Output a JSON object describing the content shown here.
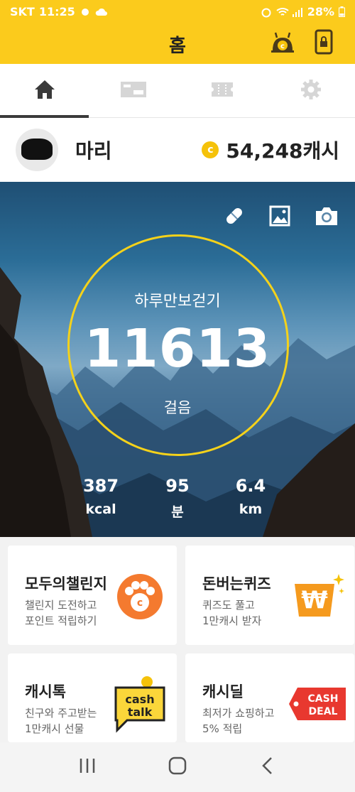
{
  "status_bar": {
    "carrier": "SKT",
    "time": "11:25",
    "battery": "28%"
  },
  "header": {
    "title": "홈"
  },
  "tabs": [
    {
      "name": "home-icon",
      "active": true
    },
    {
      "name": "ticket-icon",
      "active": false
    },
    {
      "name": "coupon-icon",
      "active": false
    },
    {
      "name": "gear-icon",
      "active": false
    }
  ],
  "profile": {
    "name": "마리",
    "cash_label": "54,248캐시",
    "coin_symbol": "c"
  },
  "walk": {
    "goal_label": "하루만보걷기",
    "steps": "11613",
    "steps_unit": "걸음",
    "stats": [
      {
        "value": "387",
        "unit": "kcal"
      },
      {
        "value": "95",
        "unit": "분"
      },
      {
        "value": "6.4",
        "unit": "km"
      }
    ]
  },
  "cards": [
    {
      "title": "모두의챌린지",
      "desc_line1": "챌린지 도전하고",
      "desc_line2": "포인트 적립하기"
    },
    {
      "title": "돈버는퀴즈",
      "desc_line1": "퀴즈도 풀고",
      "desc_line2": "1만캐시 받자"
    },
    {
      "title": "캐시톡",
      "desc_line1": "친구와 주고받는",
      "desc_line2": "1만캐시 선물",
      "logo_line1": "cash",
      "logo_line2": "talk"
    },
    {
      "title": "캐시딜",
      "desc_line1": "최저가 쇼핑하고",
      "desc_line2": "5% 적립",
      "logo_line1": "CASH",
      "logo_line2": "DEAL"
    }
  ],
  "colors": {
    "brand_yellow": "#fbcb1c",
    "accent_orange": "#f47a2f",
    "deal_red": "#e8382f"
  }
}
